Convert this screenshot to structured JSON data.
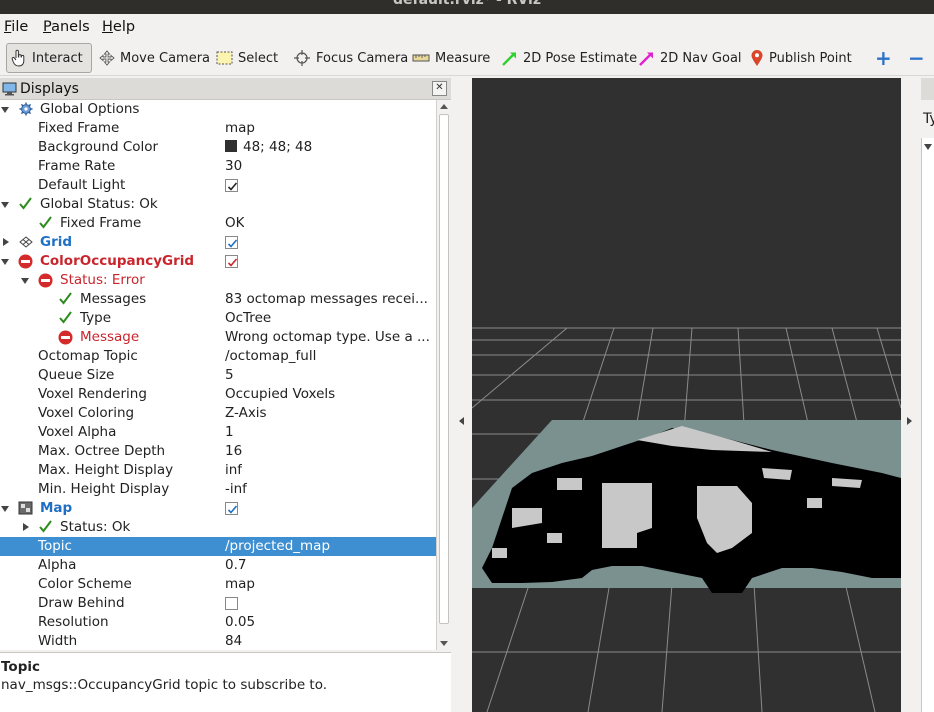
{
  "window": {
    "title": "default.rviz* - RViz"
  },
  "menu": [
    {
      "key": "F",
      "rest": "ile"
    },
    {
      "key": "P",
      "rest": "anels"
    },
    {
      "key": "H",
      "rest": "elp"
    }
  ],
  "toolbar": {
    "interact": "Interact",
    "move_camera": "Move Camera",
    "select": "Select",
    "focus_camera": "Focus Camera",
    "measure": "Measure",
    "pose_estimate": "2D Pose Estimate",
    "nav_goal": "2D Nav Goal",
    "publish_point": "Publish Point",
    "add": "+",
    "remove": "−"
  },
  "displays": {
    "title": "Displays",
    "close": "✕",
    "rows": {
      "global_options": "Global Options",
      "fixed_frame": {
        "label": "Fixed Frame",
        "value": "map"
      },
      "background_color": {
        "label": "Background Color",
        "value": "48; 48; 48",
        "swatch": "#303030"
      },
      "frame_rate": {
        "label": "Frame Rate",
        "value": "30"
      },
      "default_light": {
        "label": "Default Light"
      },
      "global_status": "Global Status: Ok",
      "gs_fixed_frame": {
        "label": "Fixed Frame",
        "value": "OK"
      },
      "grid": "Grid",
      "coloroccupancygrid": "ColorOccupancyGrid",
      "status_error": "Status: Error",
      "messages": {
        "label": "Messages",
        "value": "83 octomap messages recei..."
      },
      "type": {
        "label": "Type",
        "value": "OcTree"
      },
      "message": {
        "label": "Message",
        "value": "Wrong octomap type. Use a ..."
      },
      "octomap_topic": {
        "label": "Octomap Topic",
        "value": "/octomap_full"
      },
      "queue_size": {
        "label": "Queue Size",
        "value": "5"
      },
      "voxel_rendering": {
        "label": "Voxel Rendering",
        "value": "Occupied Voxels"
      },
      "voxel_coloring": {
        "label": "Voxel Coloring",
        "value": "Z-Axis"
      },
      "voxel_alpha": {
        "label": "Voxel Alpha",
        "value": "1"
      },
      "max_octree_depth": {
        "label": "Max. Octree Depth",
        "value": "16"
      },
      "max_height": {
        "label": "Max. Height Display",
        "value": "inf"
      },
      "min_height": {
        "label": "Min. Height Display",
        "value": "-inf"
      },
      "map": "Map",
      "map_status": "Status: Ok",
      "topic": {
        "label": "Topic",
        "value": "/projected_map"
      },
      "alpha": {
        "label": "Alpha",
        "value": "0.7"
      },
      "color_scheme": {
        "label": "Color Scheme",
        "value": "map"
      },
      "draw_behind": {
        "label": "Draw Behind"
      },
      "resolution": {
        "label": "Resolution",
        "value": "0.05"
      },
      "width": {
        "label": "Width",
        "value": "84"
      }
    }
  },
  "description": {
    "heading": "Topic",
    "text": "nav_msgs::OccupancyGrid topic to subscribe to."
  },
  "right_panel": {
    "label": "Ty"
  },
  "colors": {
    "viewport_bg": "#303030",
    "selection": "#3d8fd1",
    "status_ok": "#2e8b1f",
    "status_error": "#c9252c",
    "link_blue": "#1f6fc4"
  }
}
